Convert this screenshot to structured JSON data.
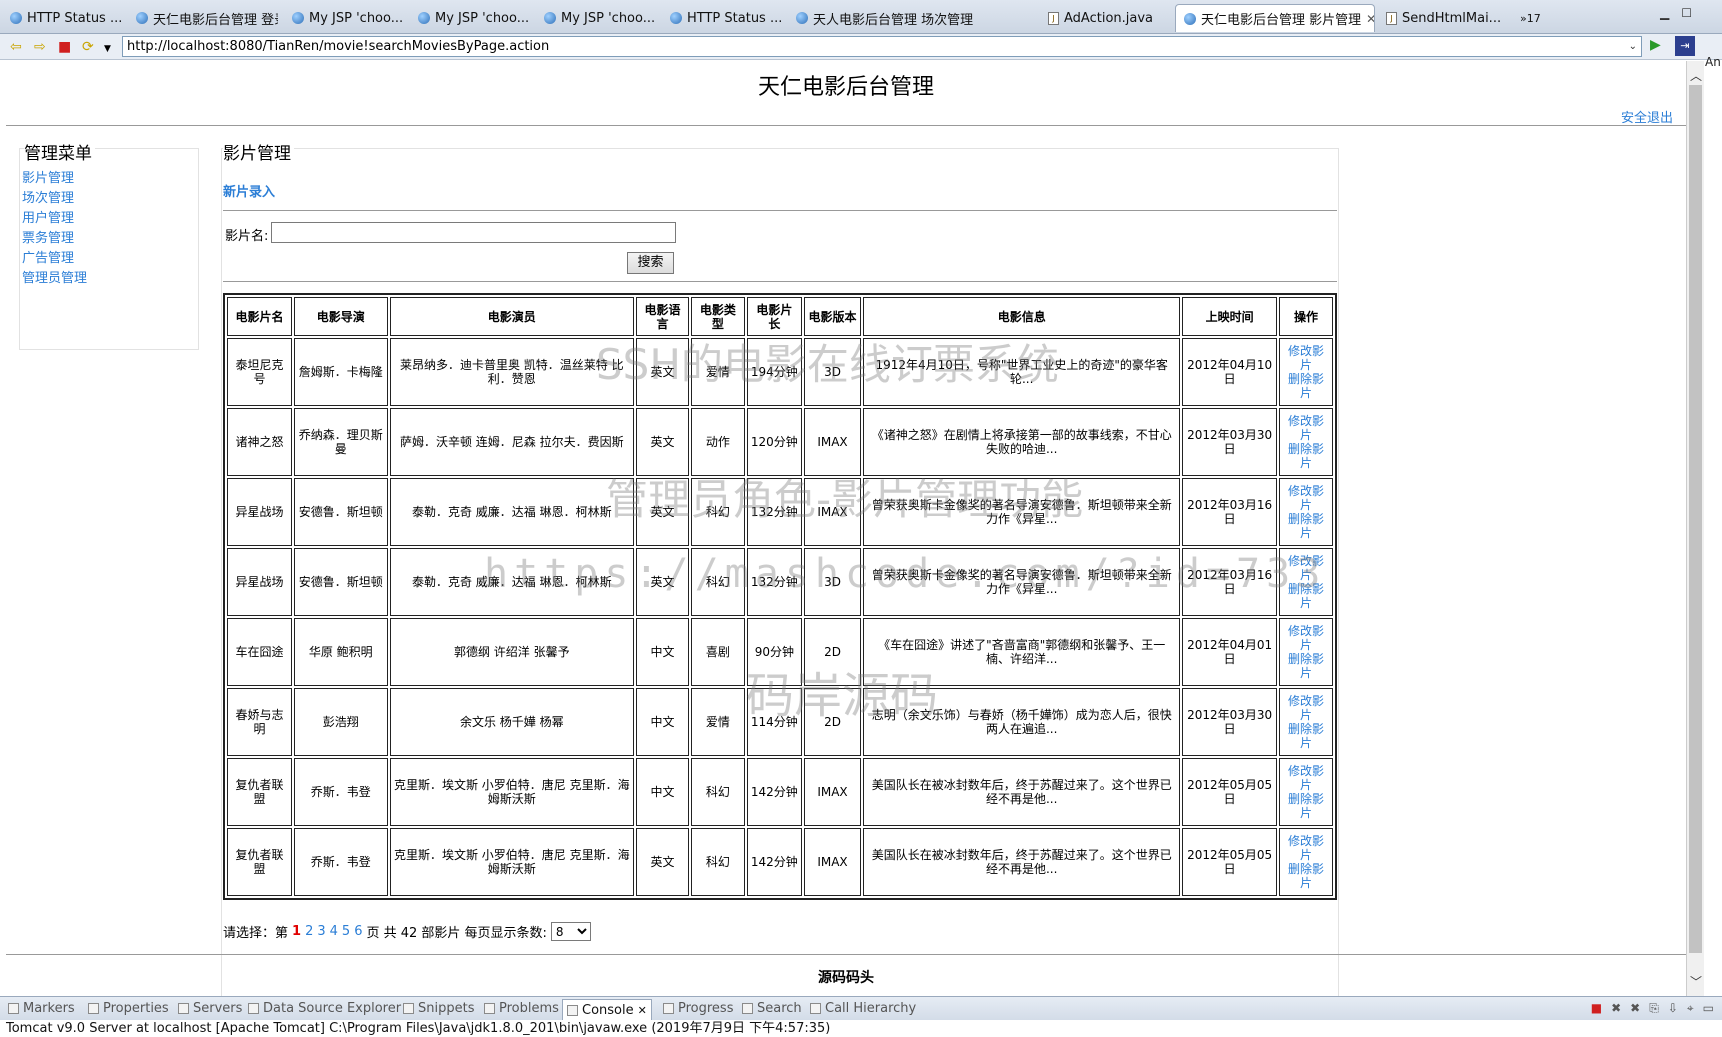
{
  "browser": {
    "tabs": [
      {
        "label": "HTTP Status ...",
        "icon": "globe-icon",
        "active": false
      },
      {
        "label": "天仁电影后台管理 登录",
        "icon": "globe-icon",
        "active": false
      },
      {
        "label": "My JSP 'choo...",
        "icon": "globe-icon",
        "active": false
      },
      {
        "label": "My JSP 'choo...",
        "icon": "globe-icon",
        "active": false
      },
      {
        "label": "My JSP 'choo...",
        "icon": "globe-icon",
        "active": false
      },
      {
        "label": "HTTP Status ...",
        "icon": "globe-icon",
        "active": false
      },
      {
        "label": "天人电影后台管理 场次管理",
        "icon": "globe-icon",
        "active": false
      },
      {
        "label": "AdAction.java",
        "icon": "java-file-icon",
        "active": false
      },
      {
        "label": "天仁电影后台管理 影片管理",
        "icon": "globe-icon",
        "active": true
      },
      {
        "label": "SendHtmlMai...",
        "icon": "java-file-icon",
        "active": false
      }
    ],
    "overflow_tabs": "»17",
    "url": "http://localhost:8080/TianRen/movie!searchMoviesByPage.action",
    "side_stub": "An"
  },
  "site": {
    "title": "天仁电影后台管理",
    "logout": "安全退出",
    "footer": "源码码头"
  },
  "sidebar": {
    "title": "管理菜单",
    "items": [
      "影片管理",
      "场次管理",
      "用户管理",
      "票务管理",
      "广告管理",
      "管理员管理"
    ]
  },
  "main": {
    "section_title": "影片管理",
    "new_link": "新片录入",
    "search": {
      "label": "影片名:",
      "value": "",
      "button": "搜索"
    }
  },
  "table": {
    "headers": [
      "电影片名",
      "电影导演",
      "电影演员",
      "电影语言",
      "电影类型",
      "电影片长",
      "电影版本",
      "电影信息",
      "上映时间",
      "操作"
    ],
    "edit_label": "修改影片",
    "delete_label": "删除影片",
    "rows": [
      [
        "泰坦尼克号",
        "詹姆斯．卡梅隆",
        "莱昂纳多．迪卡普里奥 凯特．温丝莱特 比利．赞恩",
        "英文",
        "爱情",
        "194分钟",
        "3D",
        "1912年4月10日，号称\"世界工业史上的奇迹\"的豪华客轮...",
        "2012年04月10日"
      ],
      [
        "诸神之怒",
        "乔纳森．理贝斯曼",
        "萨姆．沃辛顿 连姆．尼森 拉尔夫．费因斯",
        "英文",
        "动作",
        "120分钟",
        "IMAX",
        "《诸神之怒》在剧情上将承接第一部的故事线索，不甘心失败的哈迪...",
        "2012年03月30日"
      ],
      [
        "异星战场",
        "安德鲁．斯坦顿",
        "泰勒．克奇 威廉．达福 琳恩．柯林斯",
        "英文",
        "科幻",
        "132分钟",
        "IMAX",
        "曾荣获奥斯卡金像奖的著名导演安德鲁．斯坦顿带来全新力作《异星...",
        "2012年03月16日"
      ],
      [
        "异星战场",
        "安德鲁．斯坦顿",
        "泰勒．克奇 威廉．达福 琳恩．柯林斯",
        "英文",
        "科幻",
        "132分钟",
        "3D",
        "曾荣获奥斯卡金像奖的著名导演安德鲁．斯坦顿带来全新力作《异星...",
        "2012年03月16日"
      ],
      [
        "车在囧途",
        "华原 鲍积明",
        "郭德纲 许绍洋 张馨予",
        "中文",
        "喜剧",
        "90分钟",
        "2D",
        "《车在囧途》讲述了\"吝啬富商\"郭德纲和张馨予、王一楠、许绍洋...",
        "2012年04月01日"
      ],
      [
        "春娇与志明",
        "彭浩翔",
        "余文乐 杨千嬅 杨幂",
        "中文",
        "爱情",
        "114分钟",
        "2D",
        "志明（余文乐饰）与春娇（杨千嬅饰）成为恋人后，很快两人在遍追...",
        "2012年03月30日"
      ],
      [
        "复仇者联盟",
        "乔斯．韦登",
        "克里斯．埃文斯 小罗伯特．唐尼 克里斯．海姆斯沃斯",
        "中文",
        "科幻",
        "142分钟",
        "IMAX",
        "美国队长在被冰封数年后，终于苏醒过来了。这个世界已经不再是他...",
        "2012年05月05日"
      ],
      [
        "复仇者联盟",
        "乔斯．韦登",
        "克里斯．埃文斯 小罗伯特．唐尼 克里斯．海姆斯沃斯",
        "英文",
        "科幻",
        "142分钟",
        "IMAX",
        "美国队长在被冰封数年后，终于苏醒过来了。这个世界已经不再是他...",
        "2012年05月05日"
      ]
    ]
  },
  "pager": {
    "prefix": "请选择：第",
    "pages": [
      "1",
      "2",
      "3",
      "4",
      "5",
      "6"
    ],
    "current": "1",
    "suffix": "页 共 42 部影片 每页显示条数:",
    "page_size": "8"
  },
  "watermarks": [
    "SSH的电影在线订票系统",
    "管理员角色-影片管理功能",
    "https://mashcode.com/?id=733",
    "码岸源码"
  ],
  "ide": {
    "view_tabs": [
      "Markers",
      "Properties",
      "Servers",
      "Data Source Explorer",
      "Snippets",
      "Problems",
      "Console",
      "Progress",
      "Search",
      "Call Hierarchy"
    ],
    "active_view": "Console",
    "console_line": "Tomcat v9.0 Server at localhost [Apache Tomcat] C:\\Program Files\\Java\\jdk1.8.0_201\\bin\\javaw.exe (2019年7月9日 下午4:57:35)"
  },
  "colors": {
    "link": "#2b7ed6",
    "current_page": "#e00000",
    "tab_bar": "#dfe6f0"
  }
}
